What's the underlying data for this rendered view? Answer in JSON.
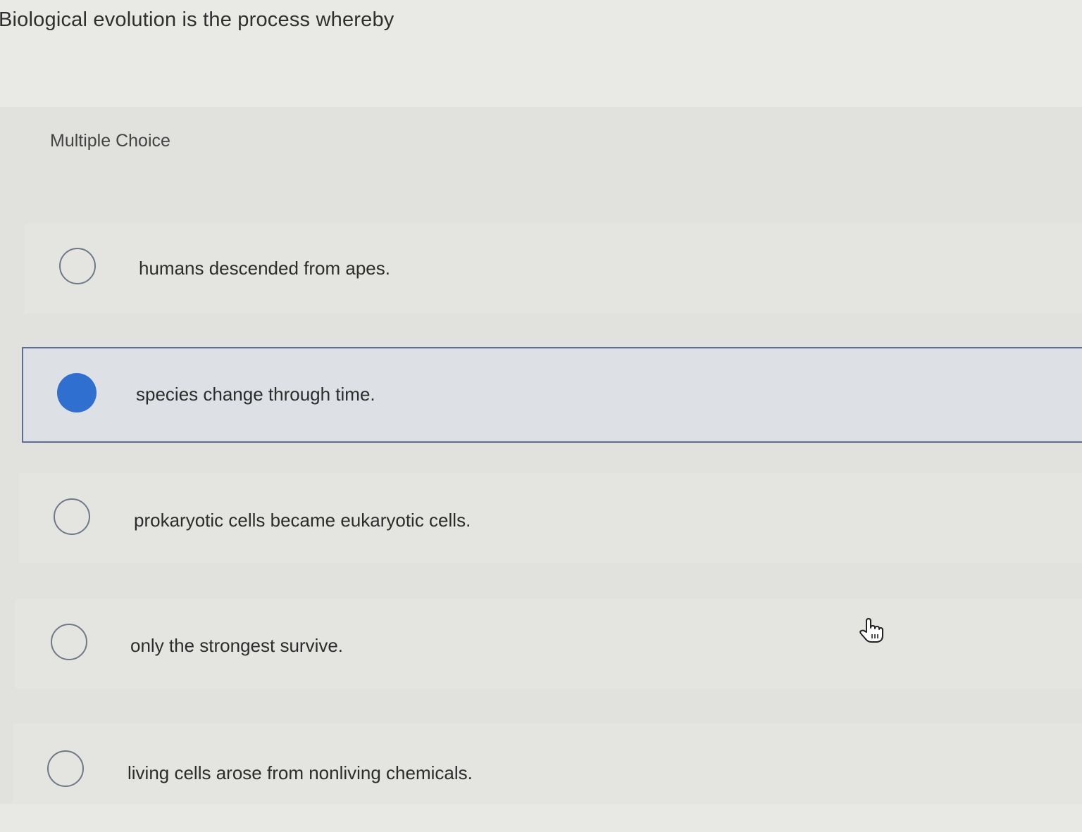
{
  "question": {
    "text": "Biological evolution is the process whereby"
  },
  "question_type": "Multiple Choice",
  "options": [
    {
      "label": "humans descended from apes.",
      "selected": false
    },
    {
      "label": "species change through time.",
      "selected": true
    },
    {
      "label": "prokaryotic cells became eukaryotic cells.",
      "selected": false
    },
    {
      "label": "only the strongest survive.",
      "selected": false
    },
    {
      "label": "living cells arose from nonliving chemicals.",
      "selected": false
    }
  ],
  "colors": {
    "accent": "#2f6fd0",
    "selected_border": "#5c6e95",
    "radio_border": "#6e7a86"
  },
  "icons": {
    "cursor": "hand-pointer-icon"
  }
}
